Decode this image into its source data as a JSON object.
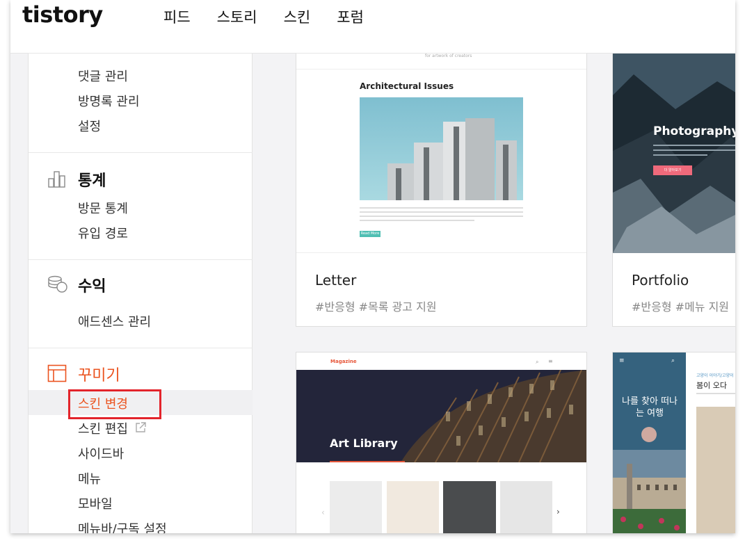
{
  "header": {
    "logo": "tistory",
    "nav": [
      "피드",
      "스토리",
      "스킨",
      "포럼"
    ]
  },
  "sidebar": {
    "comments_group": [
      "댓글 관리",
      "방명록 관리",
      "설정"
    ],
    "stats": {
      "title": "통계",
      "items": [
        "방문 통계",
        "유입 경로"
      ]
    },
    "revenue": {
      "title": "수익",
      "items": [
        "애드센스 관리"
      ]
    },
    "decorate": {
      "title": "꾸미기",
      "items": [
        "스킨 변경",
        "스킨 편집",
        "사이드바",
        "메뉴",
        "모바일",
        "메뉴바/구독 설정"
      ]
    }
  },
  "skins": [
    {
      "name": "Letter",
      "tags": "#반응형   #목록 광고 지원",
      "preview_title": "Architectural Issues",
      "preview_top": "for artwork of creators",
      "preview_button": "Read More"
    },
    {
      "name": "Portfolio",
      "tags": "#반응형   #메뉴 지원",
      "preview_title": "Photography",
      "preview_button": "더 알아보기"
    },
    {
      "preview_brand": "Magazine",
      "preview_title": "Art Library"
    },
    {
      "preview_title": "나를 찾아 떠나는 여행",
      "preview_side_top": "고양이 이야기/고양이",
      "preview_side_title": "봄이 오다"
    }
  ],
  "colors": {
    "accent": "#eb531f",
    "highlight": "#e3242b",
    "teal": "#4fbfb3"
  }
}
